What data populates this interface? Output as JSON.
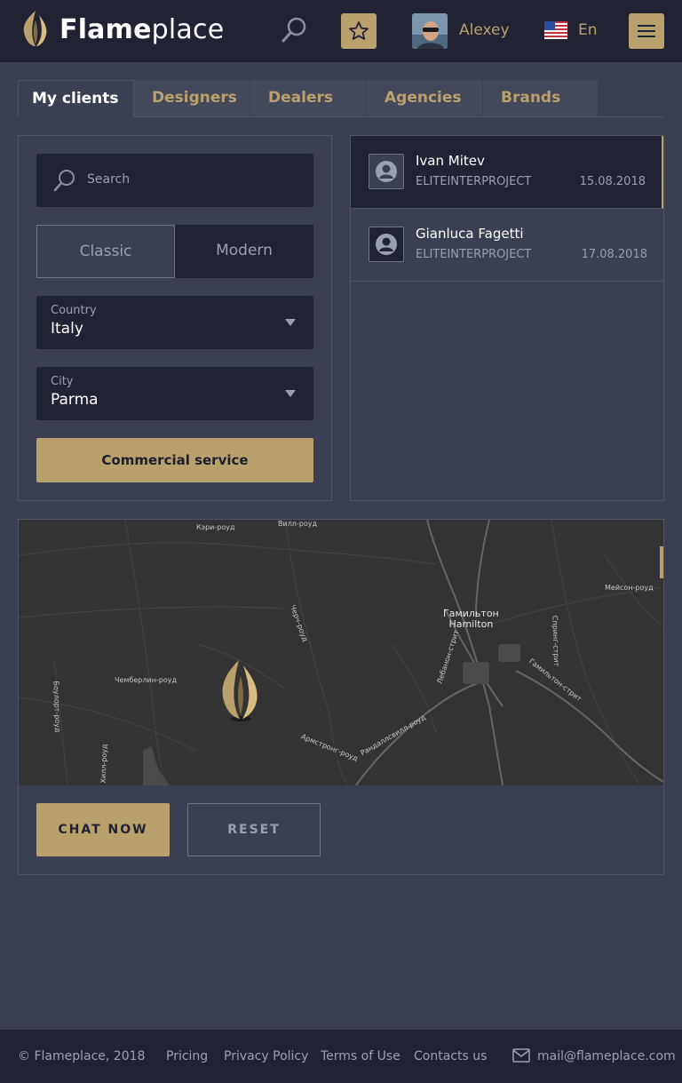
{
  "header": {
    "brand_bold": "Flame",
    "brand_light": "place",
    "username": "Alexey",
    "language": "En"
  },
  "tabs": [
    {
      "label": "My clients",
      "active": true
    },
    {
      "label": "Designers"
    },
    {
      "label": "Dealers"
    },
    {
      "label": "Agencies"
    },
    {
      "label": "Brands"
    }
  ],
  "filters": {
    "search_placeholder": "Search",
    "style_options": [
      "Classic",
      "Modern"
    ],
    "country_label": "Country",
    "country_value": "Italy",
    "city_label": "City",
    "city_value": "Parma",
    "commercial_label": "Commercial service"
  },
  "clients": [
    {
      "name": "Ivan Mitev",
      "company": "ELITEINTERPROJECT",
      "date": "15.08.2018"
    },
    {
      "name": "Gianluca Fagetti",
      "company": "ELITEINTERPROJECT",
      "date": "17.08.2018"
    }
  ],
  "map": {
    "city_ru": "Гамильтон",
    "city_en": "Hamilton",
    "labels": [
      "Кэри-роуд",
      "Вилл-роуд",
      "Мейсон-роуд",
      "Чемберлин-роуд",
      "Черч-роуд",
      "Лебанон-стрит",
      "Гамильтон-стрит",
      "Армстронг-роуд",
      "Рандаллсвилл-роуд",
      "Спринг-стрит",
      "Боулорт-роуд",
      "Хилл-роуд"
    ]
  },
  "actions": {
    "chat_label": "CHAT NOW",
    "reset_label": "RESET"
  },
  "footer": {
    "copyright": "© Flameplace, 2018",
    "links": [
      "Pricing",
      "Privacy Policy",
      "Terms of Use",
      "Contacts us"
    ],
    "email": "mail@flameplace.com"
  },
  "colors": {
    "accent": "#b9a06d",
    "dark": "#212333",
    "background": "#3b3f52"
  }
}
